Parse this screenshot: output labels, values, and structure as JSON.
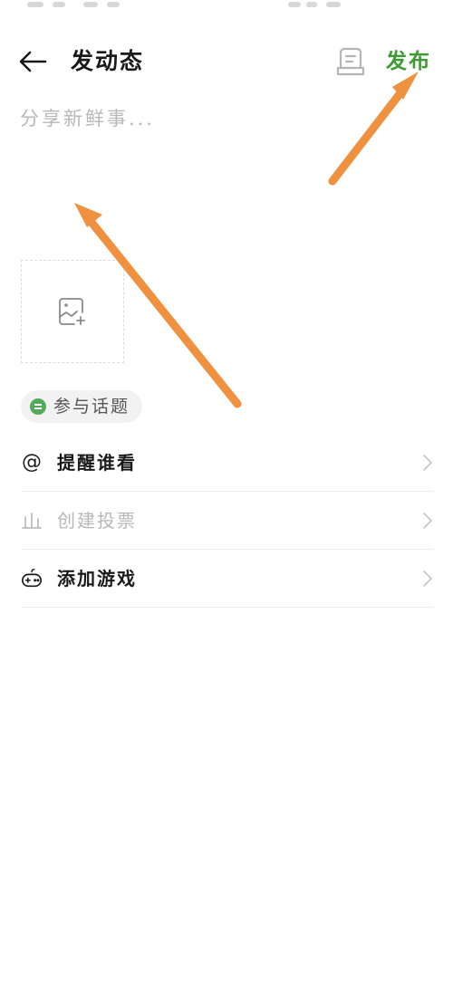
{
  "header": {
    "title": "发动态",
    "publish_label": "发布"
  },
  "composer": {
    "placeholder": "分享新鲜事...",
    "topic_chip_label": "参与话题"
  },
  "options": [
    {
      "label": "提醒谁看",
      "icon": "at-icon",
      "enabled": true
    },
    {
      "label": "创建投票",
      "icon": "poll-chart-icon",
      "enabled": false
    },
    {
      "label": "添加游戏",
      "icon": "gamepad-icon",
      "enabled": true
    }
  ],
  "colors": {
    "accent_green": "#3f9a34",
    "annotation_arrow": "#f0913f",
    "placeholder_gray": "#b8b8b8",
    "topic_dot": "#55a95a"
  }
}
